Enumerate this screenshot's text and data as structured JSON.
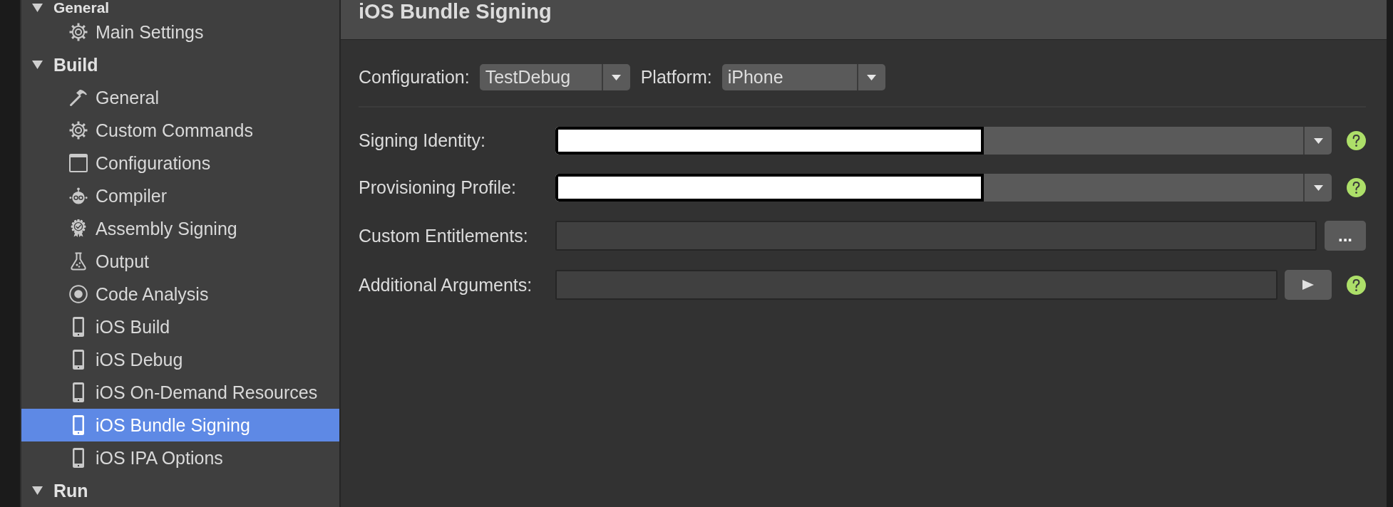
{
  "sidebar": {
    "groups": [
      {
        "label": "General",
        "expanded": true,
        "items": [
          {
            "label": "Main Settings",
            "kind": "gear",
            "selected": false
          }
        ]
      },
      {
        "label": "Build",
        "expanded": true,
        "items": [
          {
            "label": "General",
            "kind": "hammer",
            "selected": false
          },
          {
            "label": "Custom Commands",
            "kind": "gear",
            "selected": false
          },
          {
            "label": "Configurations",
            "kind": "window",
            "selected": false
          },
          {
            "label": "Compiler",
            "kind": "robot",
            "selected": false
          },
          {
            "label": "Assembly Signing",
            "kind": "seal",
            "selected": false
          },
          {
            "label": "Output",
            "kind": "flask",
            "selected": false
          },
          {
            "label": "Code Analysis",
            "kind": "target",
            "selected": false
          },
          {
            "label": "iOS Build",
            "kind": "phone",
            "selected": false
          },
          {
            "label": "iOS Debug",
            "kind": "phone",
            "selected": false
          },
          {
            "label": "iOS On-Demand Resources",
            "kind": "phone",
            "selected": false
          },
          {
            "label": "iOS Bundle Signing",
            "kind": "phone",
            "selected": true
          },
          {
            "label": "iOS IPA Options",
            "kind": "phone",
            "selected": false
          }
        ]
      },
      {
        "label": "Run",
        "expanded": true
      }
    ]
  },
  "panel": {
    "title": "iOS Bundle Signing",
    "selectors": [
      {
        "label": "Configuration:",
        "value": "TestDebug"
      },
      {
        "label": "Platform:",
        "value": "iPhone"
      }
    ],
    "rows": [
      {
        "label": "Signing Identity:",
        "kind": "combo",
        "redacted": true,
        "help": true
      },
      {
        "label": "Provisioning Profile:",
        "kind": "combo",
        "redacted": true,
        "help": true
      },
      {
        "label": "Custom Entitlements:",
        "kind": "text",
        "button": {
          "kind": "browse",
          "label": "..."
        }
      },
      {
        "label": "Additional Arguments:",
        "kind": "text",
        "button": {
          "kind": "run"
        },
        "help": true
      }
    ]
  }
}
